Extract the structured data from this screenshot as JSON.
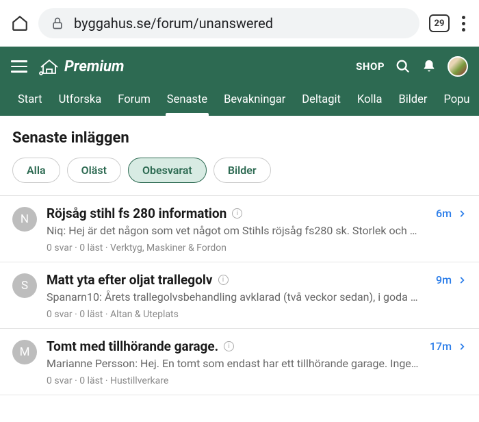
{
  "browser": {
    "url": "byggahus.se/forum/unanswered",
    "tab_count": "29"
  },
  "header": {
    "premium_label": "Premium",
    "shop_label": "SHOP",
    "nav_tabs": [
      {
        "label": "Start",
        "active": false
      },
      {
        "label": "Utforska",
        "active": false
      },
      {
        "label": "Forum",
        "active": false
      },
      {
        "label": "Senaste",
        "active": true
      },
      {
        "label": "Bevakningar",
        "active": false
      },
      {
        "label": "Deltagit",
        "active": false
      },
      {
        "label": "Kolla",
        "active": false
      },
      {
        "label": "Bilder",
        "active": false
      },
      {
        "label": "Popu",
        "active": false
      }
    ]
  },
  "content": {
    "page_title": "Senaste inläggen",
    "filters": [
      {
        "label": "Alla",
        "active": false
      },
      {
        "label": "Oläst",
        "active": false
      },
      {
        "label": "Obesvarat",
        "active": true
      },
      {
        "label": "Bilder",
        "active": false
      }
    ],
    "threads": [
      {
        "avatar_initial": "N",
        "title": "Röjsåg stihl fs 280 information",
        "time": "6m",
        "excerpt": "Niq: Hej är det någon som vet något om Stihls röjsåg fs280 sk. Storlek och …",
        "meta": "0 svar · 0 läst · Verktyg, Maskiner & Fordon"
      },
      {
        "avatar_initial": "S",
        "title": "Matt yta efter oljat trallegolv",
        "time": "9m",
        "excerpt": "Spanarn10: Årets trallegolvsbehandling avklarad (två veckor sedan), i goda …",
        "meta": "0 svar · 0 läst · Altan & Uteplats"
      },
      {
        "avatar_initial": "M",
        "title": "Tomt med tillhörande garage.",
        "time": "17m",
        "excerpt": "Marianne Persson: Hej. En tomt som endast har ett tillhörande garage. Inge…",
        "meta": "0 svar · 0 läst · Hustillverkare"
      }
    ]
  }
}
